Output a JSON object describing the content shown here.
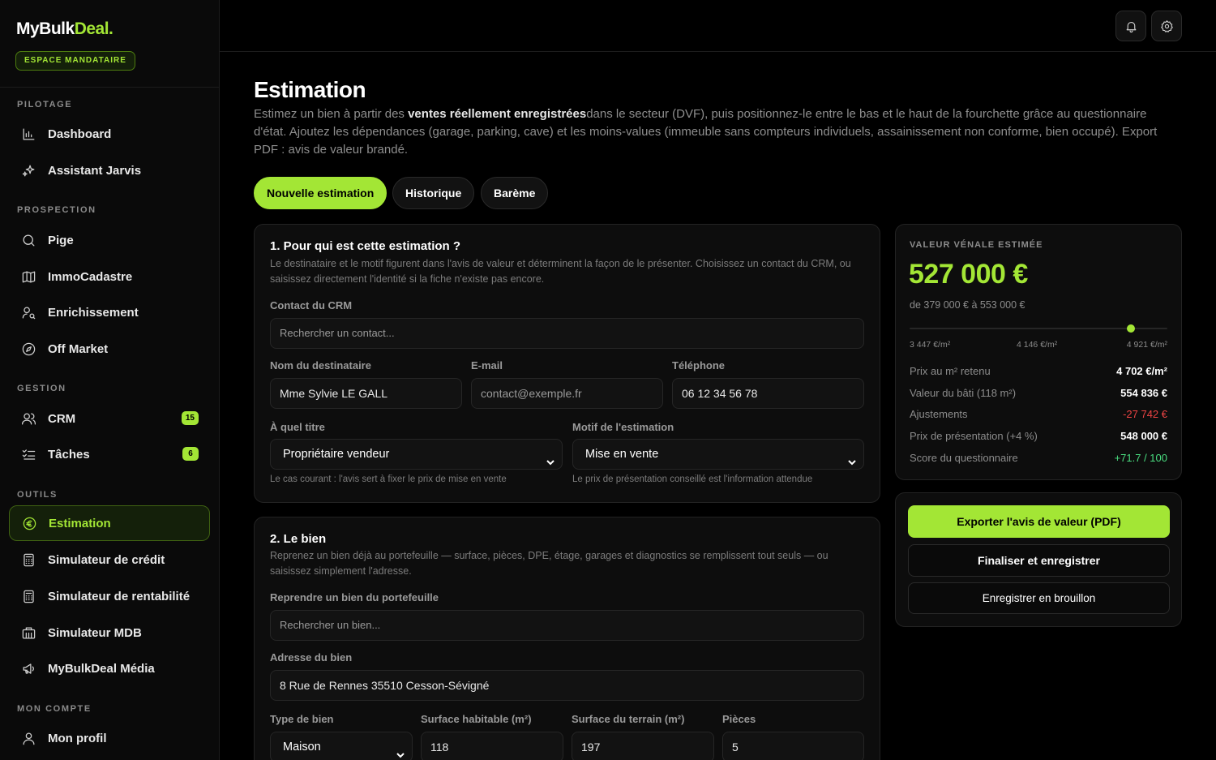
{
  "brand": {
    "name_main": "MyBulk",
    "name_accent": "Deal.",
    "space_badge": "ESPACE MANDATAIRE"
  },
  "sidebar": {
    "sections": [
      {
        "title": "PILOTAGE"
      },
      {
        "title": "PROSPECTION"
      },
      {
        "title": "GESTION"
      },
      {
        "title": "OUTILS"
      },
      {
        "title": "MON COMPTE"
      }
    ],
    "items": [
      {
        "label": "Dashboard",
        "icon": "chart-icon"
      },
      {
        "label": "Assistant Jarvis",
        "icon": "sparkles-icon"
      },
      {
        "label": "Pige",
        "icon": "search-icon"
      },
      {
        "label": "ImmoCadastre",
        "icon": "map-icon"
      },
      {
        "label": "Enrichissement",
        "icon": "user-search-icon"
      },
      {
        "label": "Off Market",
        "icon": "compass-icon"
      },
      {
        "label": "CRM",
        "icon": "users-icon",
        "count": "15"
      },
      {
        "label": "Tâches",
        "icon": "checklist-icon",
        "count": "6"
      },
      {
        "label": "Estimation",
        "icon": "euro-icon",
        "active": true
      },
      {
        "label": "Simulateur de crédit",
        "icon": "calculator-icon"
      },
      {
        "label": "Simulateur de rentabilité",
        "icon": "calculator-icon"
      },
      {
        "label": "Simulateur MDB",
        "icon": "building-icon"
      },
      {
        "label": "MyBulkDeal Média",
        "icon": "megaphone-icon"
      },
      {
        "label": "Mon profil",
        "icon": "user-icon"
      }
    ]
  },
  "topbar": {
    "icons": [
      "bell-icon",
      "gear-icon"
    ]
  },
  "page": {
    "title": "Estimation",
    "desc_prefix": "Estimez un bien à partir des ",
    "desc_bold": "ventes réellement enregistrées",
    "desc_suffix": "dans le secteur (DVF), puis positionnez-le entre le bas et le haut de la fourchette grâce au questionnaire d'état. Ajoutez les dépendances (garage, parking, cave) et les moins-values (immeuble sans compteurs individuels, assainissement non conforme, bien occupé). Export PDF : avis de valeur brandé."
  },
  "tabs": [
    {
      "label": "Nouvelle estimation",
      "active": true
    },
    {
      "label": "Historique"
    },
    {
      "label": "Barème"
    }
  ],
  "section1": {
    "title": "1. Pour qui est cette estimation ?",
    "desc": "Le destinataire et le motif figurent dans l'avis de valeur et déterminent la façon de le présenter. Choisissez un contact du CRM, ou saisissez directement l'identité si la fiche n'existe pas encore.",
    "crm_label": "Contact du CRM",
    "crm_placeholder": "Rechercher un contact...",
    "name_label": "Nom du destinataire",
    "name_value": "Mme Sylvie LE GALL",
    "email_label": "E-mail",
    "email_placeholder": "contact@exemple.fr",
    "phone_label": "Téléphone",
    "phone_value": "06 12 34 56 78",
    "role_label": "À quel titre",
    "role_value": "Propriétaire vendeur",
    "role_hint": "Le cas courant : l'avis sert à fixer le prix de mise en vente",
    "motif_label": "Motif de l'estimation",
    "motif_value": "Mise en vente",
    "motif_hint": "Le prix de présentation conseillé est l'information attendue"
  },
  "section2": {
    "title": "2. Le bien",
    "desc": "Reprenez un bien déjà au portefeuille — surface, pièces, DPE, étage, garages et diagnostics se remplissent tout seuls — ou saisissez simplement l'adresse.",
    "portfolio_label": "Reprendre un bien du portefeuille",
    "portfolio_placeholder": "Rechercher un bien...",
    "address_label": "Adresse du bien",
    "address_value": "8 Rue de Rennes 35510 Cesson-Sévigné",
    "type_label": "Type de bien",
    "type_value": "Maison",
    "surface_label": "Surface habitable (m²)",
    "surface_value": "118",
    "land_label": "Surface du terrain (m²)",
    "land_value": "197",
    "rooms_label": "Pièces",
    "rooms_value": "5"
  },
  "valuation": {
    "kicker": "VALEUR VÉNALE ESTIMÉE",
    "value": "527 000 €",
    "range": "de 379 000 € à 553 000 €",
    "scale": {
      "low": "3 447 €/m²",
      "mid": "4 146 €/m²",
      "high": "4 921 €/m²",
      "position_fraction": 0.859
    },
    "stats": [
      {
        "label": "Prix au m² retenu",
        "value": "4 702 €/m²",
        "tone": "normal"
      },
      {
        "label": "Valeur du bâti (118 m²)",
        "value": "554 836 €",
        "tone": "normal"
      },
      {
        "label": "Ajustements",
        "value": "-27 742 €",
        "tone": "neg"
      },
      {
        "label": "Prix de présentation (+4 %)",
        "value": "548 000 €",
        "tone": "normal"
      },
      {
        "label": "Score du questionnaire",
        "value": "+71.7 / 100",
        "tone": "pos"
      }
    ]
  },
  "actions": {
    "export": "Exporter l'avis de valeur (PDF)",
    "finalize": "Finaliser et enregistrer",
    "draft": "Enregistrer en brouillon"
  },
  "colors": {
    "accent": "#a3e635",
    "negative": "#ef4444",
    "positive": "#4ade80",
    "background": "#000000"
  }
}
